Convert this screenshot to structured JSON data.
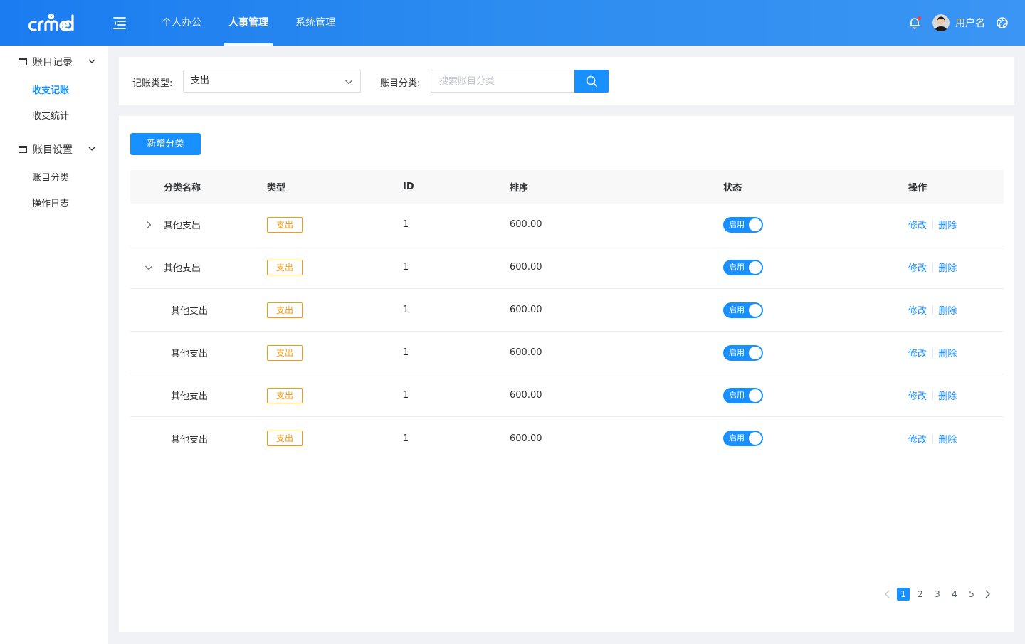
{
  "header": {
    "logo_text": "crmeb",
    "nav": [
      {
        "label": "个人办公",
        "active": false
      },
      {
        "label": "人事管理",
        "active": true
      },
      {
        "label": "系统管理",
        "active": false
      }
    ],
    "username": "用户名"
  },
  "sidebar": {
    "groups": [
      {
        "label": "账目记录",
        "items": [
          {
            "label": "收支记账",
            "active": true
          },
          {
            "label": "收支统计",
            "active": false
          }
        ]
      },
      {
        "label": "账目设置",
        "items": [
          {
            "label": "账目分类",
            "active": false
          },
          {
            "label": "操作日志",
            "active": false
          }
        ]
      }
    ]
  },
  "filter": {
    "type_label": "记账类型:",
    "type_value": "支出",
    "category_label": "账目分类:",
    "category_placeholder": "搜索账目分类"
  },
  "toolbar": {
    "add_label": "新增分类"
  },
  "table": {
    "columns": [
      "分类名称",
      "类型",
      "ID",
      "排序",
      "状态",
      "操作"
    ],
    "rows": [
      {
        "name": "其他支出",
        "type": "支出",
        "id": "1",
        "sort": "600.00",
        "status": "启用",
        "edit": "修改",
        "delete": "删除",
        "level": 0,
        "expander": "collapsed"
      },
      {
        "name": "其他支出",
        "type": "支出",
        "id": "1",
        "sort": "600.00",
        "status": "启用",
        "edit": "修改",
        "delete": "删除",
        "level": 0,
        "expander": "expanded"
      },
      {
        "name": "其他支出",
        "type": "支出",
        "id": "1",
        "sort": "600.00",
        "status": "启用",
        "edit": "修改",
        "delete": "删除",
        "level": 1,
        "expander": "none"
      },
      {
        "name": "其他支出",
        "type": "支出",
        "id": "1",
        "sort": "600.00",
        "status": "启用",
        "edit": "修改",
        "delete": "删除",
        "level": 1,
        "expander": "none"
      },
      {
        "name": "其他支出",
        "type": "支出",
        "id": "1",
        "sort": "600.00",
        "status": "启用",
        "edit": "修改",
        "delete": "删除",
        "level": 1,
        "expander": "none"
      },
      {
        "name": "其他支出",
        "type": "支出",
        "id": "1",
        "sort": "600.00",
        "status": "启用",
        "edit": "修改",
        "delete": "删除",
        "level": 1,
        "expander": "none"
      }
    ]
  },
  "pagination": {
    "pages": [
      "1",
      "2",
      "3",
      "4",
      "5"
    ],
    "current": "1"
  },
  "colors": {
    "primary": "#1890ff",
    "tag_orange": "#ff9900",
    "header_gradient_start": "#1a7cf0",
    "header_gradient_end": "#3a95f4"
  },
  "icons": [
    "menu-fold-icon",
    "bell-icon",
    "globe-icon",
    "folder-icon",
    "chevron-down-icon",
    "search-icon",
    "chevron-right-icon",
    "chevron-left-icon"
  ]
}
